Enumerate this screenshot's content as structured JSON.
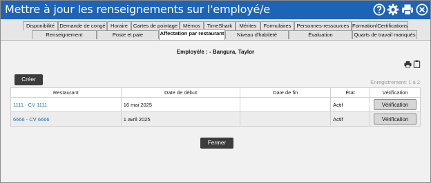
{
  "window": {
    "title": "Mettre à jour les renseignements sur l'employé/e"
  },
  "toolbar_icons": [
    "help-icon",
    "gear-icon",
    "print-icon",
    "close-icon"
  ],
  "tabs_row1": [
    "Disponibilité",
    "Demande de congé",
    "Horaire",
    "Cartes de pointage",
    "Mémos",
    "TimeShark",
    "Mérites",
    "Formulaires",
    "Personnes-ressources",
    "Formation/Certifications"
  ],
  "tabs_row2": [
    "Renseignement",
    "Poste et paie",
    "Affectation par restaurant",
    "Niveau d'habileté",
    "Évaluation",
    "Quarts de travail manqués"
  ],
  "active_tab": "Affectation par restaurant",
  "employee_label": "Employé/e : - Bangura, Taylor",
  "create_button": "Créer",
  "records_text": "Enregistrement: 1 à 2",
  "table": {
    "headers": [
      "Restaurant",
      "Date de début",
      "Date de fin",
      "État",
      "Vérification"
    ],
    "rows": [
      {
        "restaurant": "1111 - CV 1111",
        "start": "16 mai 2025",
        "end": "",
        "state": "Actif",
        "action": "Vérification"
      },
      {
        "restaurant": "6666 - CV 6666",
        "start": "1 avril 2025",
        "end": "",
        "state": "Actif",
        "action": "Vérification"
      }
    ]
  },
  "close_button": "Fermer",
  "colors": {
    "titlebar": "#1d63b7",
    "link": "#1f6fae",
    "dark_button": "#3c3c3c"
  }
}
